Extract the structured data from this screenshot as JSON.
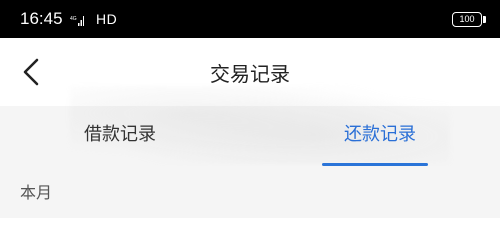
{
  "status_bar": {
    "time": "16:45",
    "signal_badge": "4G",
    "network": "HD",
    "battery": "100"
  },
  "header": {
    "back_icon": "chevron-left-icon",
    "title": "交易记录"
  },
  "tabs": [
    {
      "label": "借款记录",
      "active": false
    },
    {
      "label": "还款记录",
      "active": true
    }
  ],
  "section": {
    "label": "本月"
  },
  "colors": {
    "accent": "#2a74d8",
    "background_gray": "#f5f5f5",
    "status_bar": "#000000"
  }
}
